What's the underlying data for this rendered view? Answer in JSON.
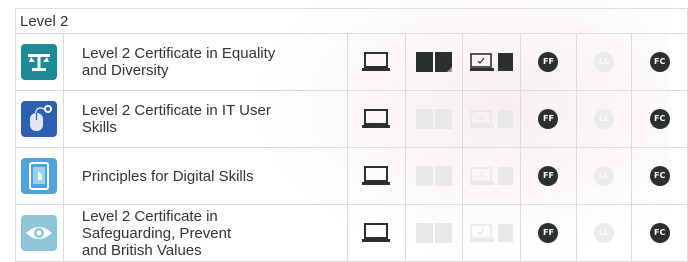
{
  "header": {
    "title": "Level 2"
  },
  "colors": {
    "dark": "#2b2f2f",
    "inactive": "#e8e8e8",
    "border": "#dcdcdc",
    "teal": "#1f8a96",
    "blue": "#2f5fb0"
  },
  "courses": [
    {
      "title_lines": [
        "Level 2 Certificate in Equality",
        "and Diversity"
      ],
      "icon": "equality-scales-icon",
      "online": true,
      "paper": true,
      "blended": true,
      "ff": "FF",
      "ff_on": true,
      "ll": "LL",
      "ll_on": false,
      "fc": "FC",
      "fc_on": true
    },
    {
      "title_lines": [
        "Level 2 Certificate in IT User",
        "Skills"
      ],
      "icon": "computer-mouse-icon",
      "online": true,
      "paper": false,
      "blended": false,
      "ff": "FF",
      "ff_on": true,
      "ll": "LL",
      "ll_on": false,
      "fc": "FC",
      "fc_on": true
    },
    {
      "title_lines": [
        "Principles for Digital Skills"
      ],
      "icon": "tablet-touch-icon",
      "online": true,
      "paper": false,
      "blended": false,
      "ff": "FF",
      "ff_on": true,
      "ll": "LL",
      "ll_on": false,
      "fc": "FC",
      "fc_on": true
    },
    {
      "title_lines": [
        "Level 2 Certificate in",
        "Safeguarding, Prevent",
        "and British Values"
      ],
      "icon": "eye-shield-icon",
      "online": true,
      "paper": false,
      "blended": false,
      "ff": "FF",
      "ff_on": true,
      "ll": "LL",
      "ll_on": false,
      "fc": "FC",
      "fc_on": true
    }
  ]
}
